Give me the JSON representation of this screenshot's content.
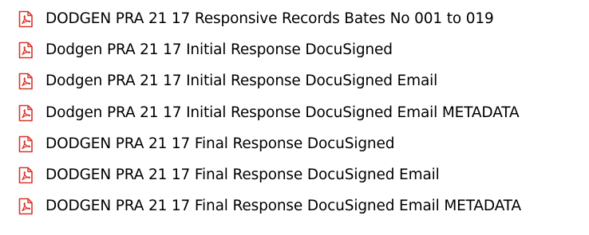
{
  "files": [
    {
      "name": "DODGEN PRA 21 17 Responsive Records Bates No 001 to 019",
      "icon": "pdf-file-icon"
    },
    {
      "name": "Dodgen PRA 21 17 Initial Response DocuSigned",
      "icon": "pdf-file-icon"
    },
    {
      "name": "Dodgen PRA 21 17 Initial Response DocuSigned Email",
      "icon": "pdf-file-icon"
    },
    {
      "name": "Dodgen PRA 21 17 Initial Response DocuSigned Email METADATA",
      "icon": "pdf-file-icon"
    },
    {
      "name": "DODGEN PRA 21 17 Final Response DocuSigned",
      "icon": "pdf-file-icon"
    },
    {
      "name": "DODGEN PRA 21 17 Final Response DocuSigned Email",
      "icon": "pdf-file-icon"
    },
    {
      "name": "DODGEN PRA 21 17 Final Response DocuSigned Email METADATA",
      "icon": "pdf-file-icon"
    }
  ],
  "colors": {
    "icon_red": "#d9352a",
    "icon_page": "#ffffff",
    "text": "#000000"
  }
}
